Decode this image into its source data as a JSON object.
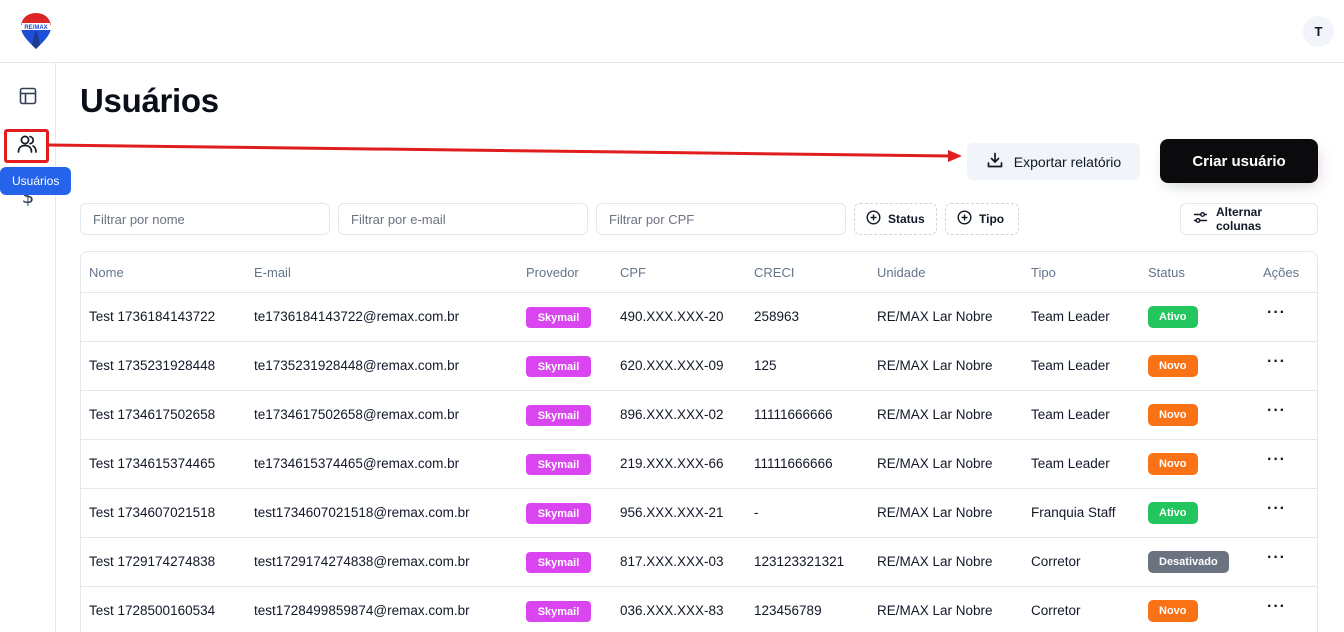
{
  "header": {
    "logo": "remax-balloon-logo",
    "logo_text": "RE/MAX",
    "avatar_initial": "T"
  },
  "sidebar": {
    "items": [
      {
        "icon": "layout-icon",
        "label": ""
      },
      {
        "icon": "users-icon",
        "label": "Usuários"
      },
      {
        "icon": "dollar-icon",
        "label": ""
      }
    ],
    "tooltip": "Usuários"
  },
  "page": {
    "title": "Usuários"
  },
  "toolbar": {
    "export_label": "Exportar relatório",
    "create_label": "Criar usuário"
  },
  "filters": {
    "nome_placeholder": "Filtrar por nome",
    "email_placeholder": "Filtrar por e-mail",
    "cpf_placeholder": "Filtrar por CPF",
    "status_label": "Status",
    "tipo_label": "Tipo",
    "columns_label": "Alternar colunas"
  },
  "table": {
    "headers": [
      "Nome",
      "E-mail",
      "Provedor",
      "CPF",
      "CRECI",
      "Unidade",
      "Tipo",
      "Status",
      "Ações"
    ],
    "rows": [
      {
        "nome": "Test 1736184143722",
        "email": "te1736184143722@remax.com.br",
        "provedor": "Skymail",
        "cpf": "490.XXX.XXX-20",
        "creci": "258963",
        "unidade": "RE/MAX Lar Nobre",
        "tipo": "Team Leader",
        "status": "Ativo"
      },
      {
        "nome": "Test 1735231928448",
        "email": "te1735231928448@remax.com.br",
        "provedor": "Skymail",
        "cpf": "620.XXX.XXX-09",
        "creci": "125",
        "unidade": "RE/MAX Lar Nobre",
        "tipo": "Team Leader",
        "status": "Novo"
      },
      {
        "nome": "Test 1734617502658",
        "email": "te1734617502658@remax.com.br",
        "provedor": "Skymail",
        "cpf": "896.XXX.XXX-02",
        "creci": "11111666666",
        "unidade": "RE/MAX Lar Nobre",
        "tipo": "Team Leader",
        "status": "Novo"
      },
      {
        "nome": "Test 1734615374465",
        "email": "te1734615374465@remax.com.br",
        "provedor": "Skymail",
        "cpf": "219.XXX.XXX-66",
        "creci": "11111666666",
        "unidade": "RE/MAX Lar Nobre",
        "tipo": "Team Leader",
        "status": "Novo"
      },
      {
        "nome": "Test 1734607021518",
        "email": "test1734607021518@remax.com.br",
        "provedor": "Skymail",
        "cpf": "956.XXX.XXX-21",
        "creci": "-",
        "unidade": "RE/MAX Lar Nobre",
        "tipo": "Franquia Staff",
        "status": "Ativo"
      },
      {
        "nome": "Test 1729174274838",
        "email": "test1729174274838@remax.com.br",
        "provedor": "Skymail",
        "cpf": "817.XXX.XXX-03",
        "creci": "123123321321",
        "unidade": "RE/MAX Lar Nobre",
        "tipo": "Corretor",
        "status": "Desativado"
      },
      {
        "nome": "Test 1728500160534",
        "email": "test1728499859874@remax.com.br",
        "provedor": "Skymail",
        "cpf": "036.XXX.XXX-83",
        "creci": "123456789",
        "unidade": "RE/MAX Lar Nobre",
        "tipo": "Corretor",
        "status": "Novo"
      }
    ],
    "actions_glyph": "···"
  },
  "colors": {
    "provider_badge": "#d946ef",
    "status_ativo": "#22c55e",
    "status_novo": "#f97316",
    "status_desativado": "#6b7280",
    "annotation_red": "#e11d1d",
    "tooltip_blue": "#2563eb",
    "create_button": "#0b0b0d"
  }
}
